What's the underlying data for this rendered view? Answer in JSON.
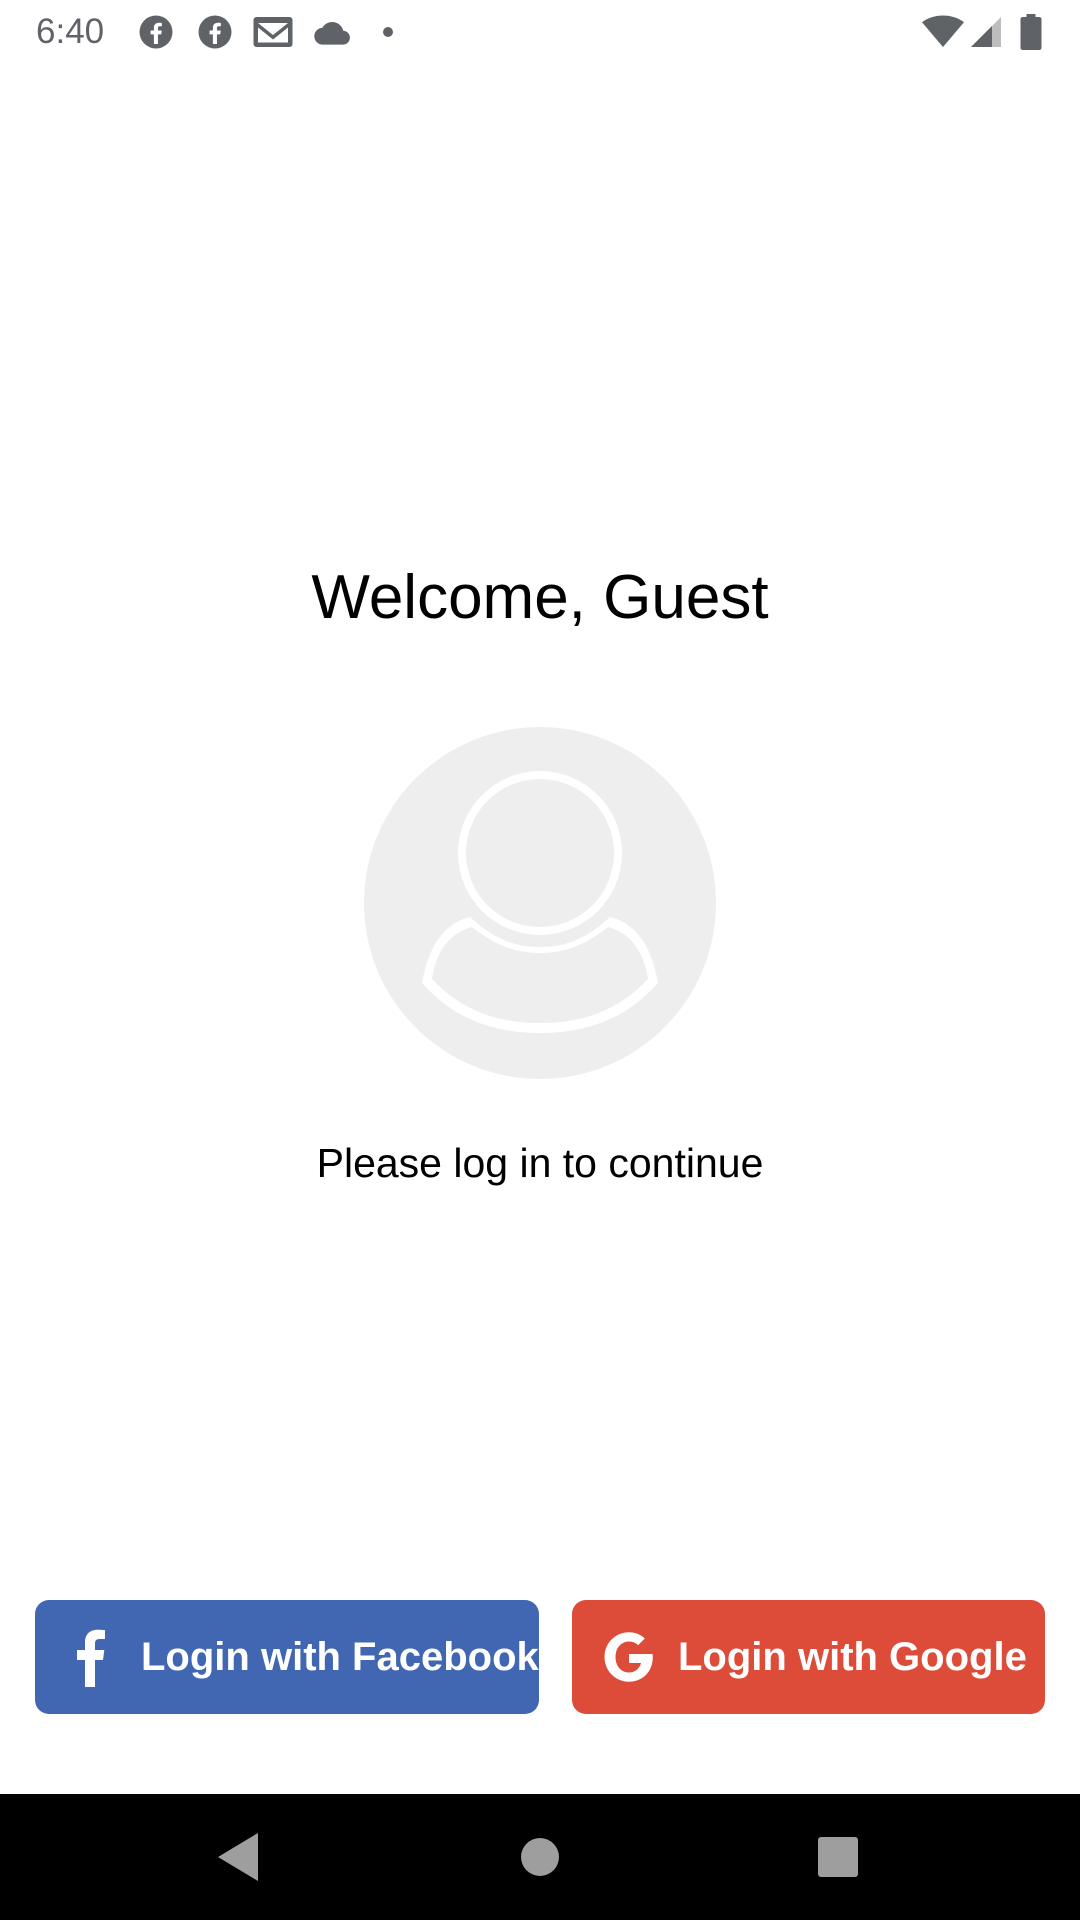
{
  "status_bar": {
    "time": "6:40",
    "left_icons": [
      "facebook-icon",
      "facebook-icon",
      "gmail-icon",
      "cloud-icon",
      "dot-icon"
    ],
    "right_icons": [
      "wifi-icon",
      "signal-icon",
      "battery-icon"
    ]
  },
  "main": {
    "title": "Welcome, Guest",
    "avatar_icon": "default-avatar-icon",
    "subtitle": "Please log in to continue"
  },
  "buttons": {
    "facebook": {
      "label": "Login with Facebook",
      "icon": "facebook-f-icon",
      "color": "#4267b2"
    },
    "google": {
      "label": "Login with Google",
      "icon": "google-g-icon",
      "color": "#dd4b39"
    }
  },
  "nav_bar": {
    "buttons": [
      "back-icon",
      "home-icon",
      "recents-icon"
    ]
  },
  "colors": {
    "background": "#ffffff",
    "avatar": "#eeeeee",
    "status_icons": "#5f6368",
    "nav_bar": "#000000",
    "nav_icons": "#9e9e9e"
  }
}
